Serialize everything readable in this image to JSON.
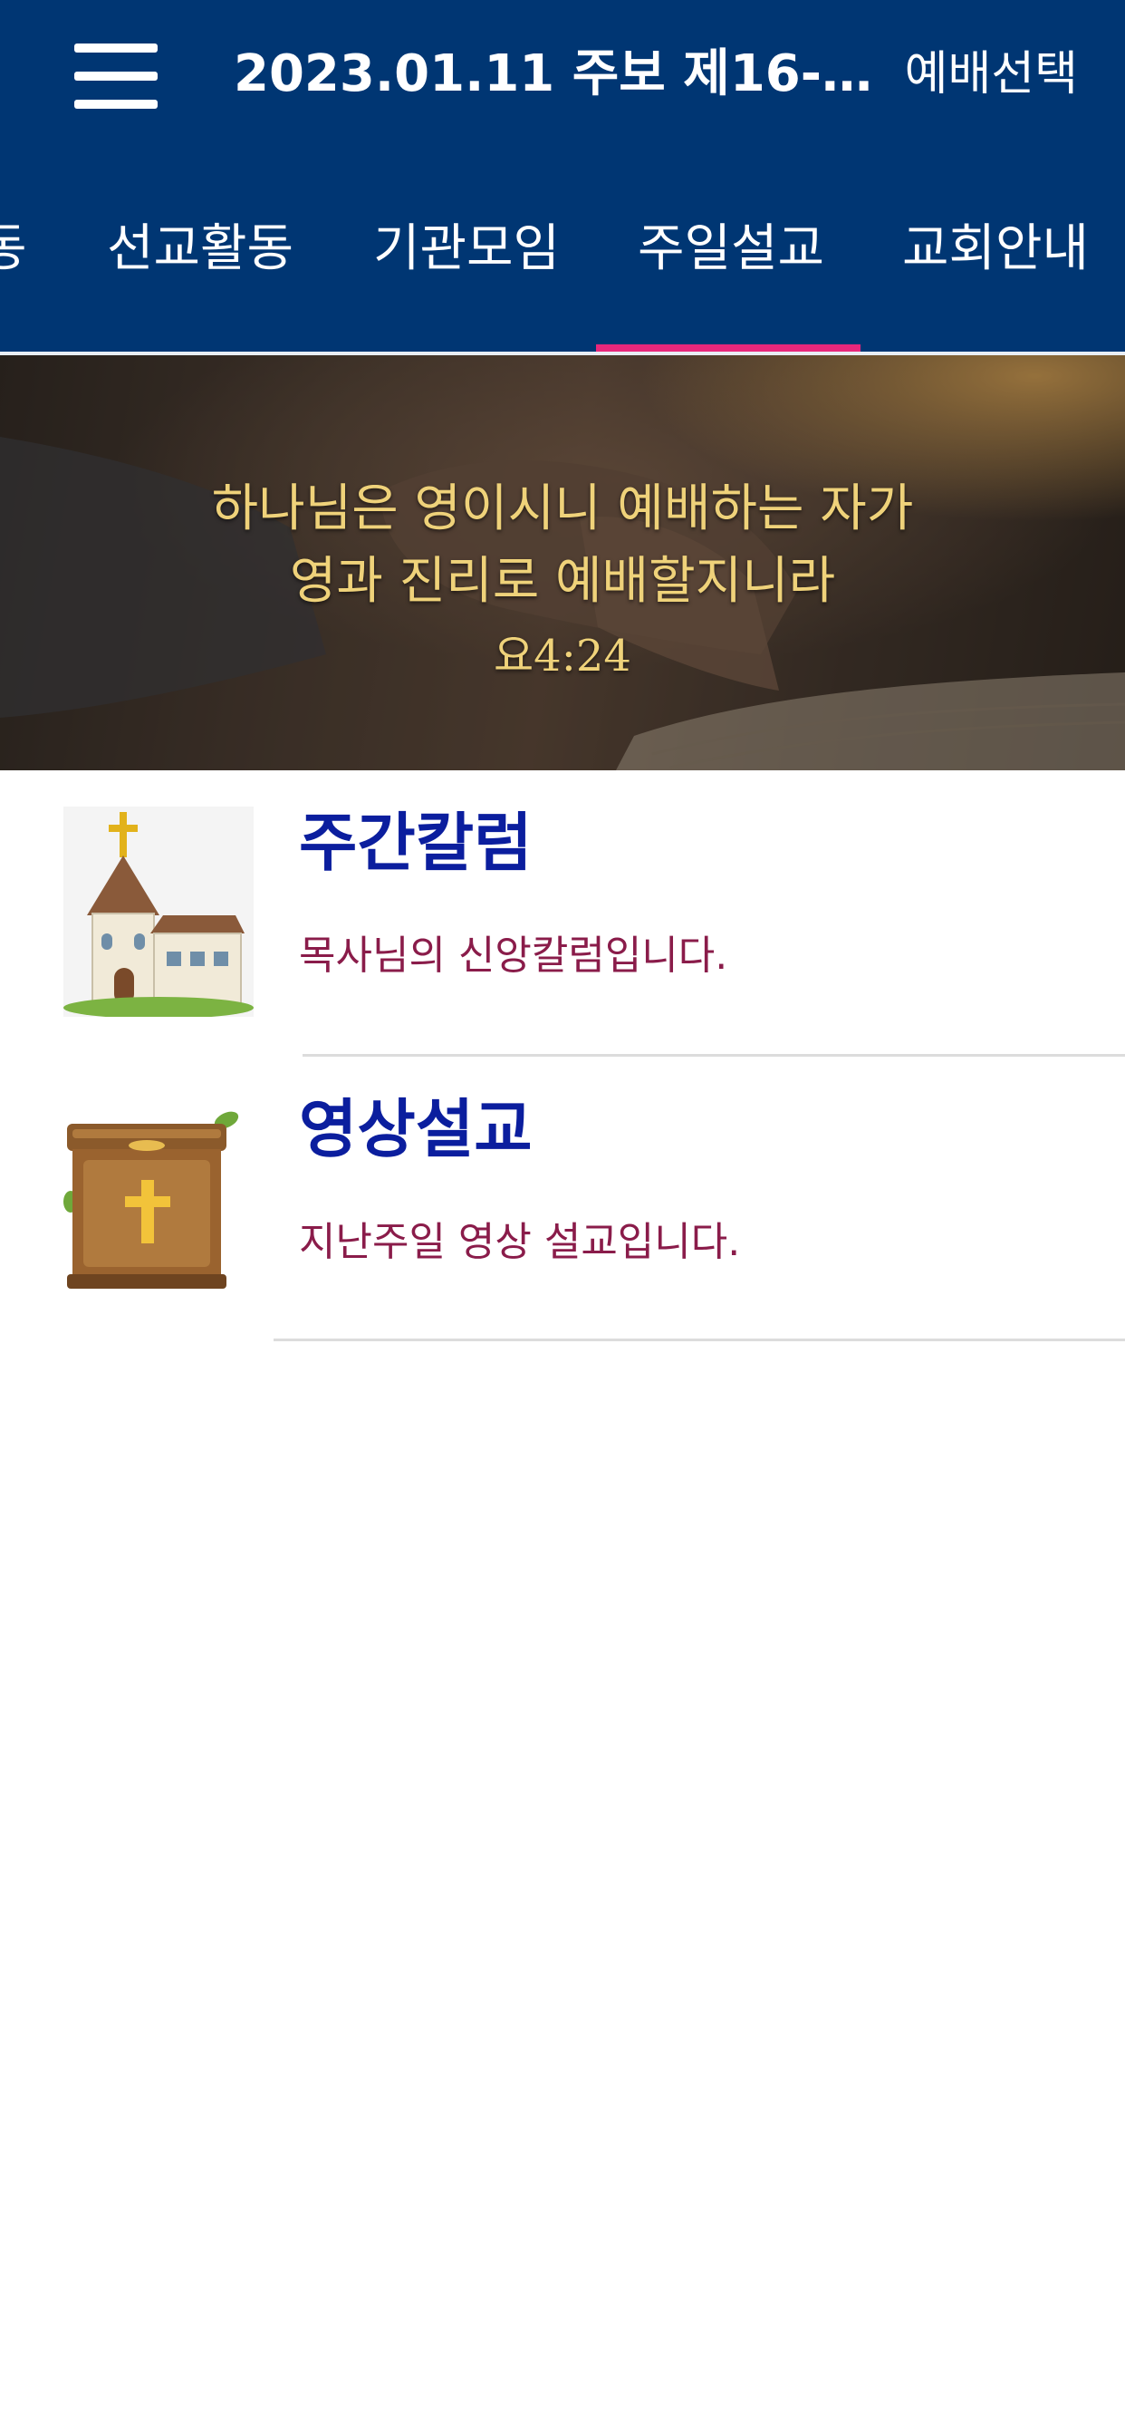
{
  "header": {
    "title": "2023.01.11 주보 제16-2021-...",
    "service_select_label": "예배선택",
    "menu_icon": "hamburger-menu-icon",
    "background_color": "#003673"
  },
  "tabs": {
    "items": [
      {
        "label": "동"
      },
      {
        "label": "선교활동"
      },
      {
        "label": "기관모임"
      },
      {
        "label": "주일설교",
        "selected": true
      },
      {
        "label": "교회안내"
      }
    ],
    "indicator_color": "#e8277b"
  },
  "banner": {
    "line1": "하나님은 영이시니 예배하는 자가",
    "line2": "영과 진리로 예배할지니라",
    "reference": "요4:24",
    "text_color": "#efd27a"
  },
  "list": {
    "items": [
      {
        "icon": "church-icon",
        "title": "주간칼럼",
        "description": "목사님의 신앙칼럼입니다."
      },
      {
        "icon": "pulpit-icon",
        "title": "영상설교",
        "description": "지난주일 영상 설교입니다."
      }
    ],
    "title_color": "#0b1e9e",
    "description_color": "#8a1c4a"
  }
}
